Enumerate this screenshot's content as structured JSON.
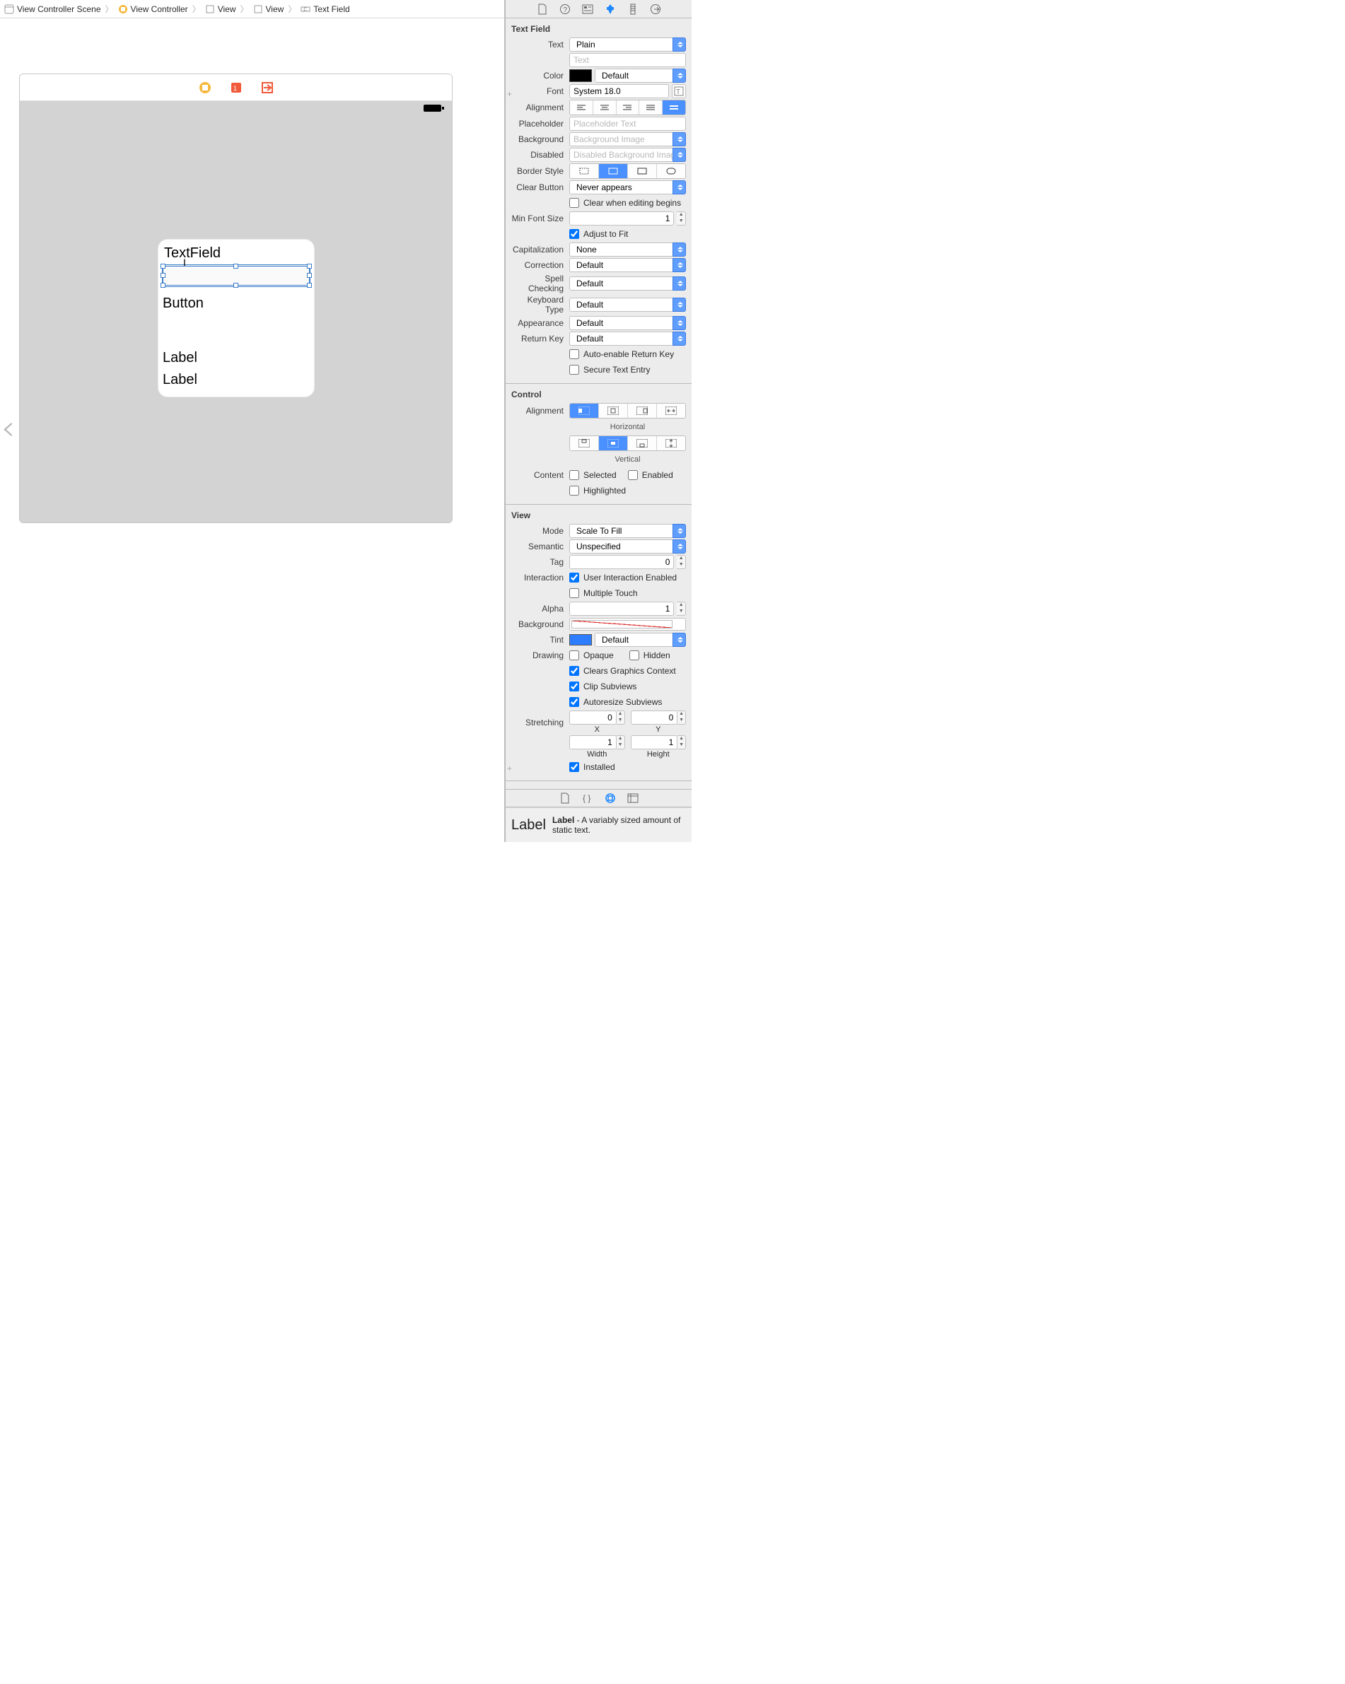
{
  "breadcrumb": {
    "item0": "View Controller Scene",
    "item1": "View Controller",
    "item2": "View",
    "item3": "View",
    "item4": "Text Field"
  },
  "canvas": {
    "textfield_label": "TextField",
    "button_label": "Button",
    "label1": "Label",
    "label2": "Label"
  },
  "inspector": {
    "tf_section": "Text Field",
    "text_label": "Text",
    "text_value": "Plain",
    "text_placeholder": "Text",
    "color_label": "Color",
    "color_value": "Default",
    "font_label": "Font",
    "font_value": "System 18.0",
    "alignment_label": "Alignment",
    "placeholder_label": "Placeholder",
    "placeholder_ph": "Placeholder Text",
    "background_label": "Background",
    "background_ph": "Background Image",
    "disabled_label": "Disabled",
    "disabled_ph": "Disabled Background Image",
    "border_style_label": "Border Style",
    "clear_button_label": "Clear Button",
    "clear_button_value": "Never appears",
    "clear_editing": "Clear when editing begins",
    "min_font_label": "Min Font Size",
    "min_font_value": "1",
    "adjust_fit": "Adjust to Fit",
    "capitalization_label": "Capitalization",
    "capitalization_value": "None",
    "correction_label": "Correction",
    "correction_value": "Default",
    "spell_label": "Spell Checking",
    "spell_value": "Default",
    "keyboard_label": "Keyboard Type",
    "keyboard_value": "Default",
    "appearance_label": "Appearance",
    "appearance_value": "Default",
    "return_label": "Return Key",
    "return_value": "Default",
    "auto_enable": "Auto-enable Return Key",
    "secure": "Secure Text Entry",
    "control_section": "Control",
    "c_alignment_label": "Alignment",
    "horizontal_caption": "Horizontal",
    "vertical_caption": "Vertical",
    "content_label": "Content",
    "selected": "Selected",
    "enabled": "Enabled",
    "highlighted": "Highlighted",
    "view_section": "View",
    "mode_label": "Mode",
    "mode_value": "Scale To Fill",
    "semantic_label": "Semantic",
    "semantic_value": "Unspecified",
    "tag_label": "Tag",
    "tag_value": "0",
    "interaction_label": "Interaction",
    "user_interaction": "User Interaction Enabled",
    "multiple_touch": "Multiple Touch",
    "alpha_label": "Alpha",
    "alpha_value": "1",
    "bg2_label": "Background",
    "tint_label": "Tint",
    "tint_value": "Default",
    "drawing_label": "Drawing",
    "opaque": "Opaque",
    "hidden": "Hidden",
    "clears_gc": "Clears Graphics Context",
    "clip_subviews": "Clip Subviews",
    "autoresize": "Autoresize Subviews",
    "stretching_label": "Stretching",
    "stretch_x": "0",
    "stretch_y": "0",
    "stretch_w": "1",
    "stretch_h": "1",
    "x_caption": "X",
    "y_caption": "Y",
    "w_caption": "Width",
    "h_caption": "Height",
    "installed": "Installed"
  },
  "library": {
    "thumb": "Label",
    "name": "Label",
    "sep": " - ",
    "desc": "A variably sized amount of static text."
  }
}
